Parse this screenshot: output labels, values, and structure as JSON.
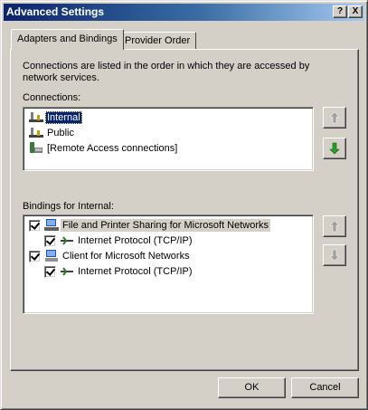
{
  "window": {
    "title": "Advanced Settings",
    "help_glyph": "?",
    "close_glyph": "X"
  },
  "tabs": [
    {
      "label": "Adapters and Bindings",
      "active": true
    },
    {
      "label": "Provider Order",
      "active": false
    }
  ],
  "description": "Connections are listed in the order in which they are accessed by network services.",
  "connections": {
    "label": "Connections:",
    "items": [
      {
        "label": "Internal",
        "icon": "network-connection-icon",
        "selected": true
      },
      {
        "label": "Public",
        "icon": "network-connection-icon",
        "selected": false
      },
      {
        "label": "[Remote Access connections]",
        "icon": "remote-access-icon",
        "selected": false
      }
    ],
    "move_up_icon": "arrow-up-icon",
    "move_down_icon": "arrow-down-icon"
  },
  "bindings": {
    "label": "Bindings for Internal:",
    "items": [
      {
        "label": "File and Printer Sharing for Microsoft Networks",
        "icon": "file-printer-sharing-icon",
        "checked": true,
        "level": 0,
        "highlighted": true
      },
      {
        "label": "Internet Protocol (TCP/IP)",
        "icon": "protocol-icon",
        "checked": true,
        "level": 1,
        "highlighted": false
      },
      {
        "label": "Client for Microsoft Networks",
        "icon": "network-client-icon",
        "checked": true,
        "level": 0,
        "highlighted": false
      },
      {
        "label": "Internet Protocol (TCP/IP)",
        "icon": "protocol-icon",
        "checked": true,
        "level": 1,
        "highlighted": false
      }
    ],
    "move_up_icon": "arrow-up-icon",
    "move_down_icon": "arrow-down-icon"
  },
  "buttons": {
    "ok": "OK",
    "cancel": "Cancel"
  },
  "colors": {
    "face": "#d4d0c8",
    "title_start": "#0a246a",
    "title_end": "#a6caf0",
    "selection": "#0a246a",
    "arrow_active": "#2aa02a",
    "arrow_disabled": "#a0a0a0"
  }
}
